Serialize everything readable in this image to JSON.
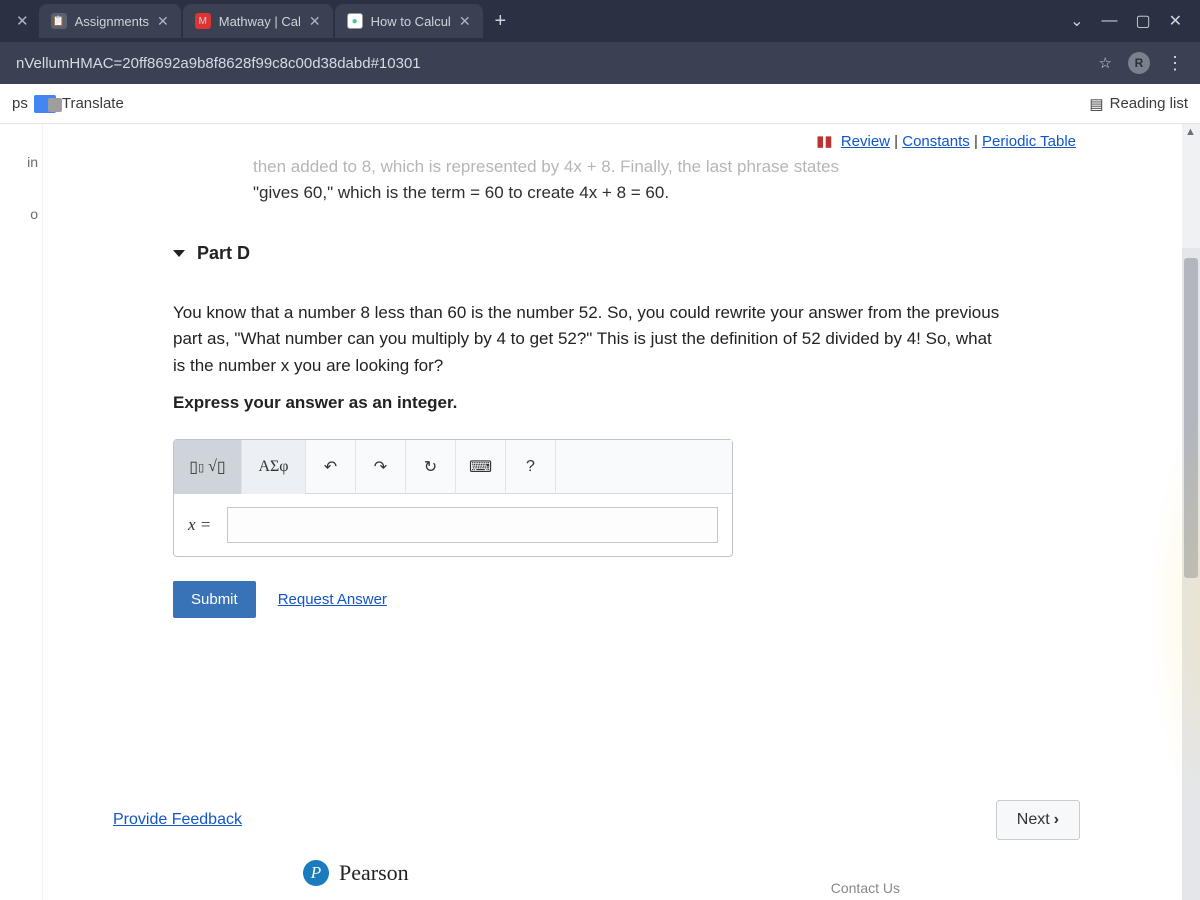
{
  "browser": {
    "tabs": [
      {
        "title": "Assignments"
      },
      {
        "title": "Mathway | Cal"
      },
      {
        "title": "How to Calcul"
      }
    ],
    "address": "nVellumHMAC=20ff8692a9b8f8628f99c8c00d38dabd#10301",
    "profile_badge": "R"
  },
  "bookmarks": {
    "left_label_prefix": "ps",
    "translate": "Translate",
    "reading_list": "Reading list"
  },
  "sidebar": {
    "items": [
      "in",
      "",
      "o"
    ]
  },
  "top_links": {
    "review": "Review",
    "constants": "Constants",
    "periodic": "Periodic Table"
  },
  "previous_text": {
    "faded": "then added to 8, which is represented by 4x + 8. Finally, the last phrase states",
    "main": "\"gives 60,\" which is the term = 60 to create 4x + 8 = 60."
  },
  "part": {
    "label": "Part D",
    "problem": "You know that a number 8 less than 60 is the number 52. So, you could rewrite your answer from the previous part as, \"What number can you multiply by 4 to get 52?\" This is just the definition of 52 divided by 4! So, what is the number x you are looking for?",
    "instruction": "Express your answer as an integer."
  },
  "answer_box": {
    "template_label": "√",
    "greek_label": "ΑΣφ",
    "prefix": "x =",
    "undo_tip": "Undo",
    "redo_tip": "Redo",
    "reset_tip": "Reset",
    "keyboard_tip": "Keyboard",
    "help_tip": "?"
  },
  "buttons": {
    "submit": "Submit",
    "request_answer": "Request Answer",
    "provide_feedback": "Provide Feedback",
    "next": "Next"
  },
  "footer": {
    "brand": "Pearson",
    "contact": "Contact Us"
  }
}
